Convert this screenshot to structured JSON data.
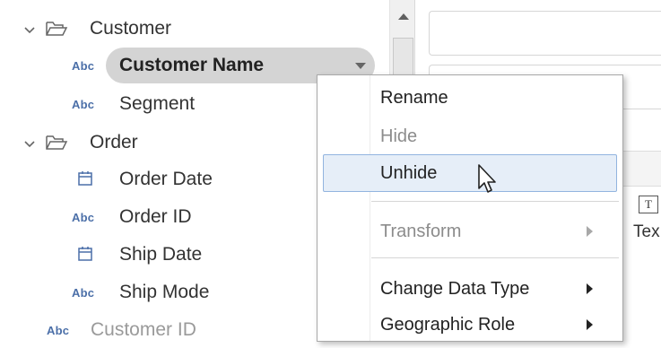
{
  "tree": {
    "items": [
      {
        "kind": "folder",
        "label": "Customer"
      },
      {
        "kind": "abc",
        "label": "Customer Name",
        "selected": true
      },
      {
        "kind": "abc",
        "label": "Segment"
      },
      {
        "kind": "folder",
        "label": "Order"
      },
      {
        "kind": "date",
        "label": "Order Date"
      },
      {
        "kind": "abc",
        "label": "Order ID"
      },
      {
        "kind": "date",
        "label": "Ship Date"
      },
      {
        "kind": "abc",
        "label": "Ship Mode"
      },
      {
        "kind": "abc",
        "label": "Customer ID",
        "hidden": true
      }
    ],
    "type_badge": "Abc"
  },
  "context_menu": {
    "items": [
      {
        "label": "Rename",
        "enabled": true
      },
      {
        "label": "Hide",
        "enabled": false
      },
      {
        "label": "Unhide",
        "enabled": true,
        "highlighted": true
      },
      {
        "label": "Transform",
        "enabled": false,
        "submenu": true
      },
      {
        "label": "Change Data Type",
        "enabled": true,
        "submenu": true
      },
      {
        "label": "Geographic Role",
        "enabled": true,
        "submenu": true
      }
    ]
  },
  "right_panel": {
    "text_button": "T",
    "text_label": "Tex"
  },
  "colors": {
    "abc_badge": "#4b6fa8",
    "selected_pill": "#d4d4d4",
    "menu_highlight": "#e6eef8",
    "menu_highlight_border": "#92b4df"
  }
}
